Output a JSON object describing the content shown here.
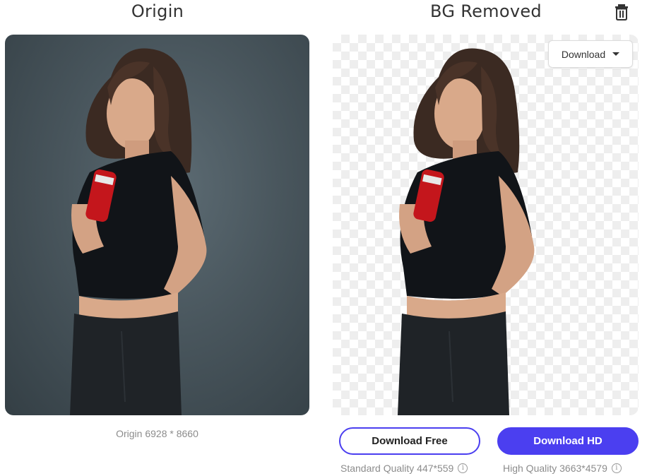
{
  "titles": {
    "origin": "Origin",
    "removed": "BG Removed"
  },
  "toolbar": {
    "delete_icon": "trash-icon",
    "download_menu_label": "Download"
  },
  "origin_info": {
    "label": "Origin 6928 * 8660"
  },
  "actions": {
    "free_label": "Download Free",
    "hd_label": "Download HD",
    "standard_quality": "Standard Quality 447*559",
    "high_quality": "High Quality 3663*4579",
    "info_icon_glyph": "i"
  },
  "colors": {
    "accent": "#4b3ff0",
    "muted_text": "#8c8c8c"
  }
}
